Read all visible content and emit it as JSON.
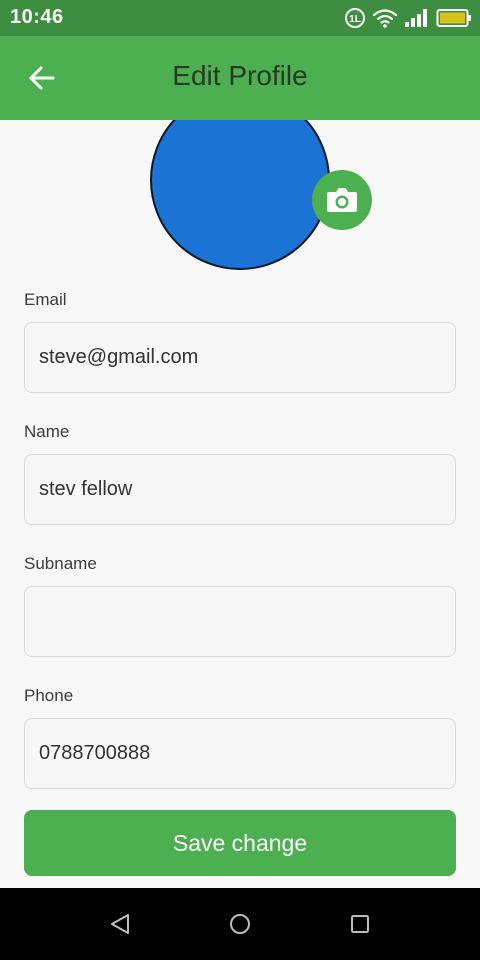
{
  "status_bar": {
    "time": "10:46",
    "volte_text": "1L",
    "icons": [
      "volte-icon",
      "wifi-icon",
      "signal-icon",
      "battery-icon"
    ],
    "colors": {
      "background": "#3e8e41",
      "battery_fill": "#d4c21f"
    }
  },
  "app_bar": {
    "title": "Edit Profile",
    "back_icon": "arrow-left-icon",
    "colors": {
      "background": "#4caf50",
      "title": "#263a27"
    }
  },
  "profile": {
    "avatar_color": "#1a73d5",
    "camera_icon": "camera-icon",
    "camera_button_color": "#4caf50"
  },
  "form": {
    "email": {
      "label": "Email",
      "value": "steve@gmail.com",
      "placeholder": ""
    },
    "name": {
      "label": "Name",
      "value": "stev fellow",
      "placeholder": ""
    },
    "subname": {
      "label": "Subname",
      "value": "",
      "placeholder": ""
    },
    "phone": {
      "label": "Phone",
      "value": "0788700888",
      "placeholder": ""
    }
  },
  "save_button": {
    "label": "Save change",
    "color": "#4caf50"
  },
  "nav_bar": {
    "icons": [
      "nav-back-icon",
      "nav-home-icon",
      "nav-recents-icon"
    ]
  }
}
